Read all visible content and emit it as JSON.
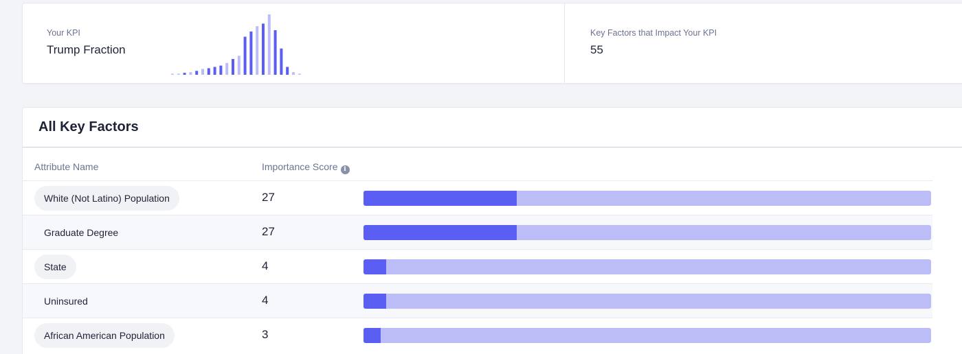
{
  "kpi": {
    "label": "Your KPI",
    "name": "Trump Fraction",
    "factors_label": "Key Factors that Impact Your KPI",
    "factors_count": "55",
    "distribution": [
      1,
      1,
      3,
      4,
      6,
      9,
      10,
      12,
      14,
      18,
      24,
      29,
      58,
      66,
      74,
      78,
      92,
      68,
      40,
      12,
      4,
      1
    ],
    "highlighted": [
      false,
      false,
      true,
      false,
      true,
      false,
      true,
      true,
      true,
      false,
      true,
      false,
      true,
      true,
      false,
      true,
      false,
      true,
      true,
      true,
      false,
      false
    ],
    "colors": {
      "accent": "#5a5ef2",
      "light": "#bcbdf6"
    }
  },
  "factors": {
    "title": "All Key Factors",
    "columns": {
      "name": "Attribute Name",
      "score": "Importance Score"
    },
    "info_icon": "info-icon",
    "max_score": 100,
    "rows": [
      {
        "name": "White (Not Latino) Population",
        "score": "27",
        "value": 27
      },
      {
        "name": "Graduate Degree",
        "score": "27",
        "value": 27
      },
      {
        "name": "State",
        "score": "4",
        "value": 4
      },
      {
        "name": "Uninsured",
        "score": "4",
        "value": 4
      },
      {
        "name": "African American Population",
        "score": "3",
        "value": 3
      }
    ]
  }
}
